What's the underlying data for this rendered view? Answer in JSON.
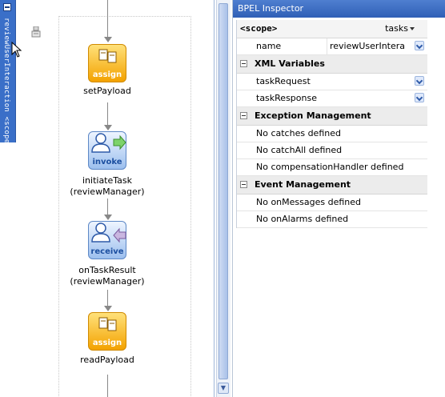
{
  "diagram": {
    "scope_label": "reviewUserInteraction <scope>",
    "activities": [
      {
        "type_label": "assign",
        "name": "setPayload",
        "partner": ""
      },
      {
        "type_label": "invoke",
        "name": "initiateTask",
        "partner": "(reviewManager)"
      },
      {
        "type_label": "receive",
        "name": "onTaskResult",
        "partner": "(reviewManager)"
      },
      {
        "type_label": "assign",
        "name": "readPayload",
        "partner": ""
      }
    ]
  },
  "inspector": {
    "title": "BPEL Inspector",
    "scope_header": "<scope>",
    "tasks_menu": "tasks",
    "properties": [
      {
        "name": "name",
        "value": "reviewUserIntera"
      }
    ],
    "sections": {
      "xml_variables": {
        "label": "XML Variables",
        "rows": [
          "taskRequest",
          "taskResponse"
        ]
      },
      "exception_management": {
        "label": "Exception Management",
        "rows": [
          "No catches defined",
          "No catchAll defined",
          "No compensationHandler defined"
        ]
      },
      "event_management": {
        "label": "Event Management",
        "rows": [
          "No onMessages defined",
          "No onAlarms defined"
        ]
      }
    }
  },
  "colors": {
    "scope_tab": "#3a6fc8",
    "assign_activity": "#f3a200",
    "invoke_activity": "#9cbfee",
    "inspector_titlebar": "#2f5fb6"
  },
  "icons": {
    "assign": "document-copy-icon",
    "invoke": "user-arrow-out-icon",
    "receive": "user-arrow-in-icon"
  }
}
